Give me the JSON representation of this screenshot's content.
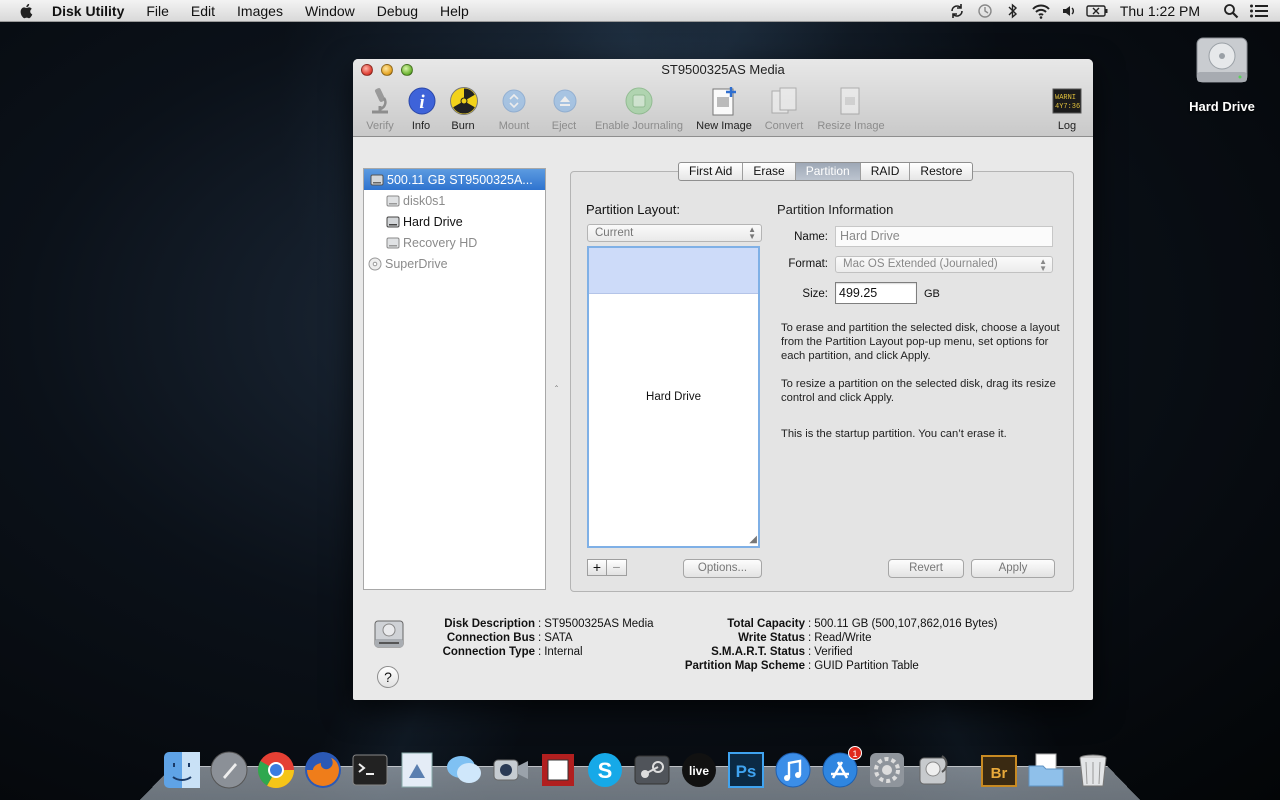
{
  "menubar": {
    "app_name": "Disk Utility",
    "items": [
      "File",
      "Edit",
      "Images",
      "Window",
      "Debug",
      "Help"
    ],
    "clock": "Thu 1:22 PM",
    "status_icons": [
      "sync-icon",
      "time-machine-icon",
      "bluetooth-icon",
      "wifi-icon",
      "volume-icon",
      "battery-icon",
      "spotlight-icon",
      "notification-center-icon"
    ]
  },
  "desktop": {
    "icon_label": "Hard Drive"
  },
  "window": {
    "title": "ST9500325AS Media",
    "toolbar": {
      "verify": "Verify",
      "info": "Info",
      "burn": "Burn",
      "mount": "Mount",
      "eject": "Eject",
      "enable_journaling": "Enable Journaling",
      "new_image": "New Image",
      "convert": "Convert",
      "resize_image": "Resize Image",
      "log": "Log",
      "log_icon_text": "WARNI\n4Y7:36"
    },
    "sidebar": {
      "items": [
        {
          "label": "500.11 GB ST9500325A..."
        },
        {
          "label": "disk0s1"
        },
        {
          "label": "Hard Drive"
        },
        {
          "label": "Recovery HD"
        },
        {
          "label": "SuperDrive"
        }
      ]
    },
    "tabs": [
      "First Aid",
      "Erase",
      "Partition",
      "RAID",
      "Restore"
    ],
    "partition": {
      "layout_label": "Partition Layout:",
      "layout_value": "Current",
      "map_partition_name": "Hard Drive",
      "add_button": "+",
      "remove_button": "−",
      "options_button": "Options...",
      "info_title": "Partition Information",
      "name_label": "Name:",
      "name_value": "Hard Drive",
      "format_label": "Format:",
      "format_value": "Mac OS Extended (Journaled)",
      "size_label": "Size:",
      "size_value": "499.25",
      "size_unit": "GB",
      "text_1": "To erase and partition the selected disk, choose a layout from the Partition Layout pop-up menu, set options for each partition, and click Apply.",
      "text_2": "To resize a partition on the selected disk, drag its resize control and click Apply.",
      "text_3": "This is the startup partition. You can’t erase it.",
      "revert_button": "Revert",
      "apply_button": "Apply"
    },
    "footer": {
      "help_button": "?",
      "disk_description_label": "Disk Description",
      "disk_description": "ST9500325AS Media",
      "connection_bus_label": "Connection Bus",
      "connection_bus": "SATA",
      "connection_type_label": "Connection Type",
      "connection_type": "Internal",
      "total_capacity_label": "Total Capacity",
      "total_capacity": "500.11 GB (500,107,862,016 Bytes)",
      "write_status_label": "Write Status",
      "write_status": "Read/Write",
      "smart_status_label": "S.M.A.R.T. Status",
      "smart_status": "Verified",
      "partition_map_label": "Partition Map Scheme",
      "partition_map": "GUID Partition Table"
    }
  },
  "dock": {
    "app_store_badge": "1",
    "photoshop_label": "Ps",
    "bridge_label": "Br",
    "live_label": "live"
  }
}
